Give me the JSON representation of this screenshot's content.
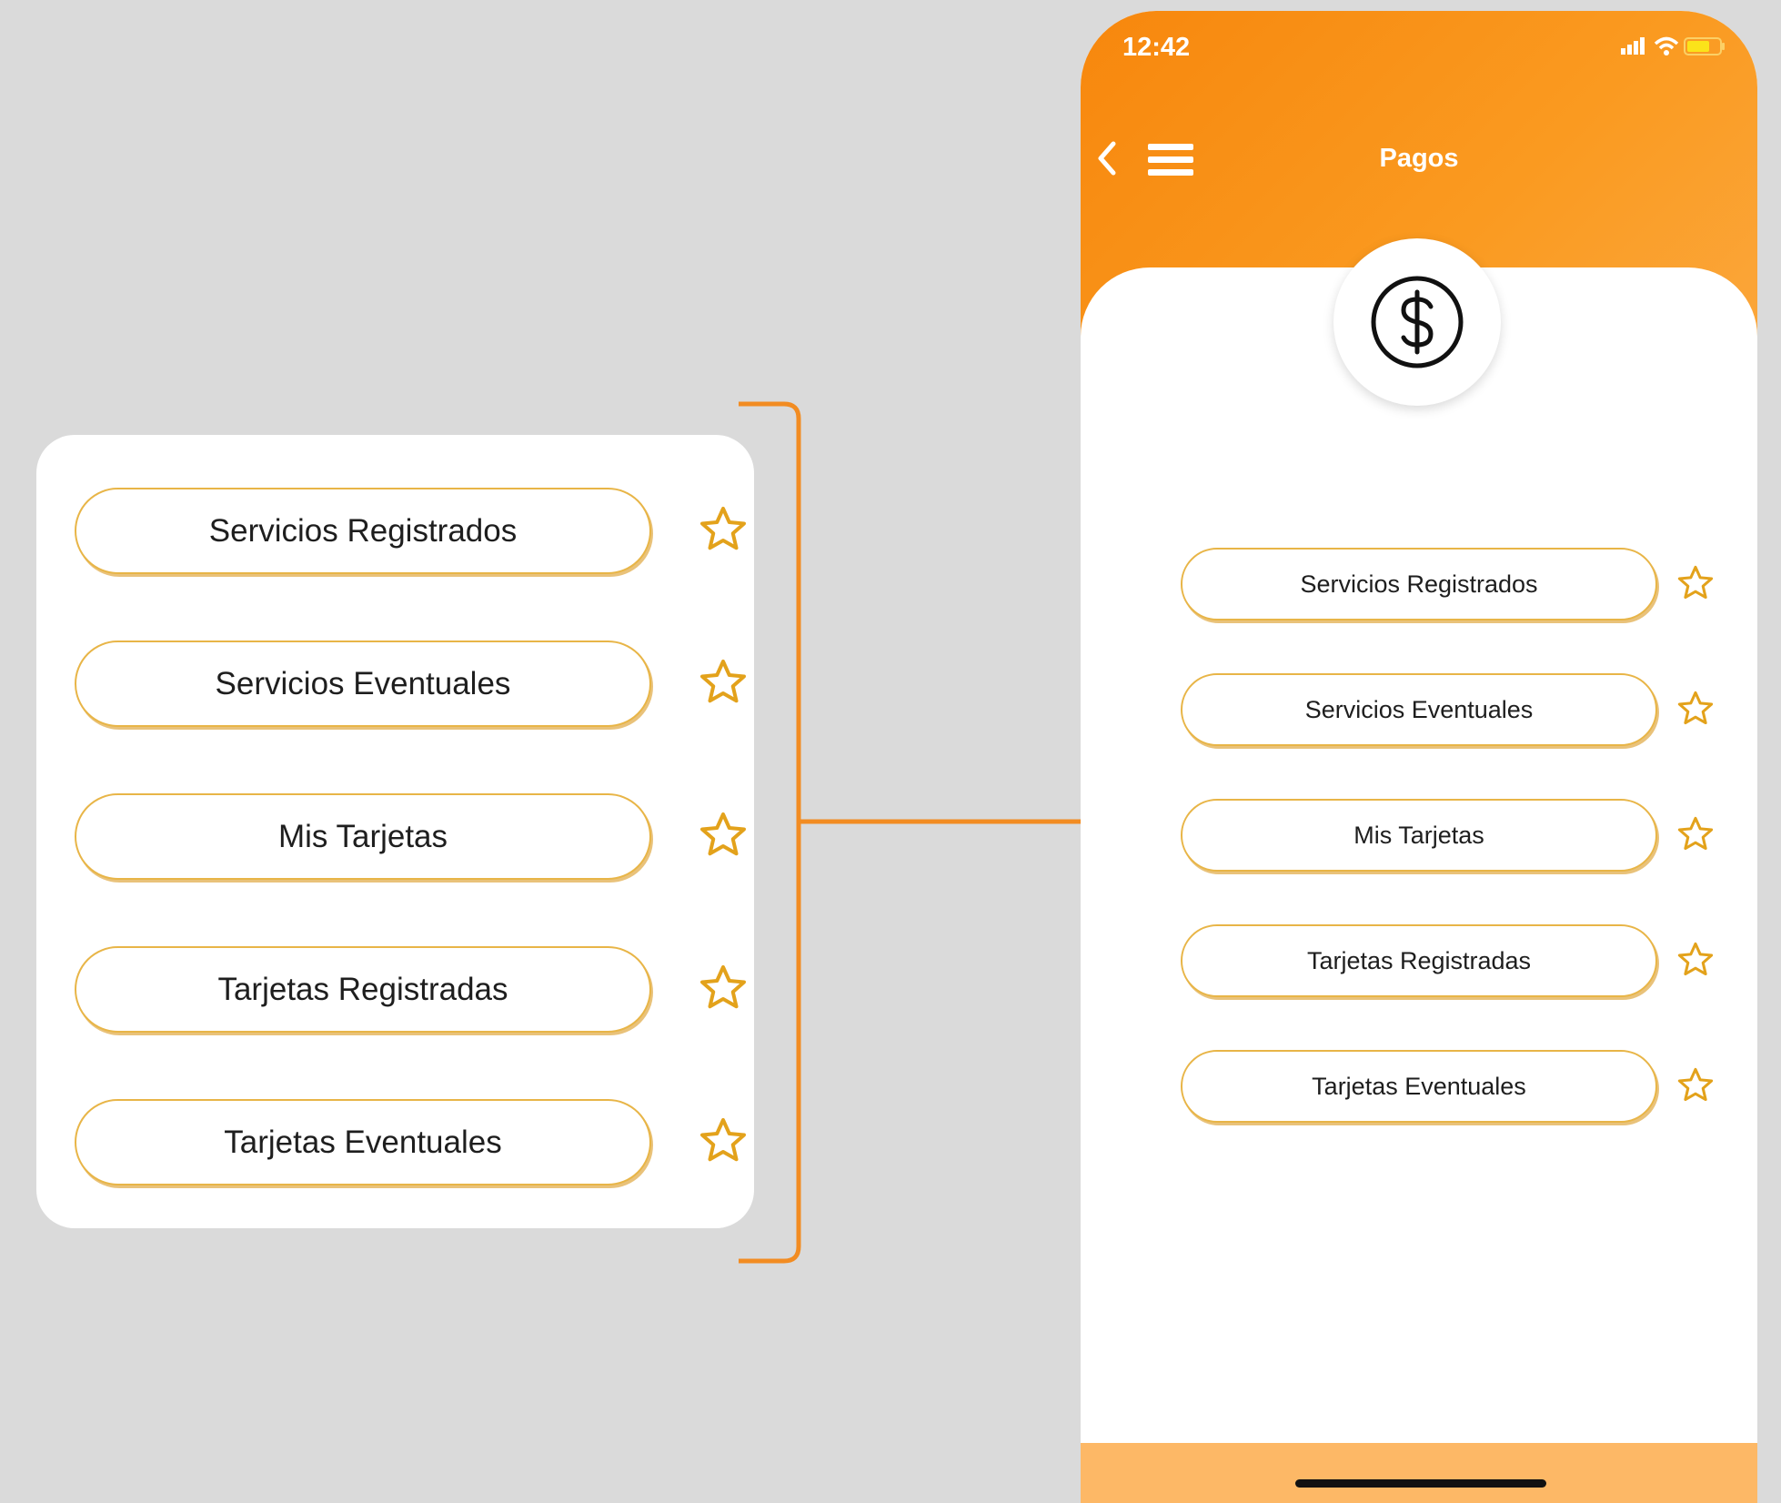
{
  "colors": {
    "accent": "#f7870d",
    "pill_border": "#e8b547",
    "star": "#e3a21b",
    "background": "#dadada"
  },
  "zoom_card": {
    "items": [
      {
        "label": "Servicios Registrados",
        "icon": "star-outline-icon"
      },
      {
        "label": "Servicios Eventuales",
        "icon": "star-outline-icon"
      },
      {
        "label": "Mis Tarjetas",
        "icon": "star-outline-icon"
      },
      {
        "label": "Tarjetas Registradas",
        "icon": "star-outline-icon"
      },
      {
        "label": "Tarjetas Eventuales",
        "icon": "star-outline-icon"
      }
    ]
  },
  "phone": {
    "status_bar": {
      "time": "12:42",
      "icons": [
        "signal-icon",
        "wifi-icon",
        "battery-icon"
      ]
    },
    "header": {
      "title": "Pagos",
      "back_icon": "chevron-left-icon",
      "menu_icon": "hamburger-menu-icon"
    },
    "hero_icon": "dollar-circle-icon",
    "items": [
      {
        "label": "Servicios Registrados",
        "icon": "star-outline-icon"
      },
      {
        "label": "Servicios Eventuales",
        "icon": "star-outline-icon"
      },
      {
        "label": "Mis Tarjetas",
        "icon": "star-outline-icon"
      },
      {
        "label": "Tarjetas Registradas",
        "icon": "star-outline-icon"
      },
      {
        "label": "Tarjetas Eventuales",
        "icon": "star-outline-icon"
      }
    ]
  }
}
